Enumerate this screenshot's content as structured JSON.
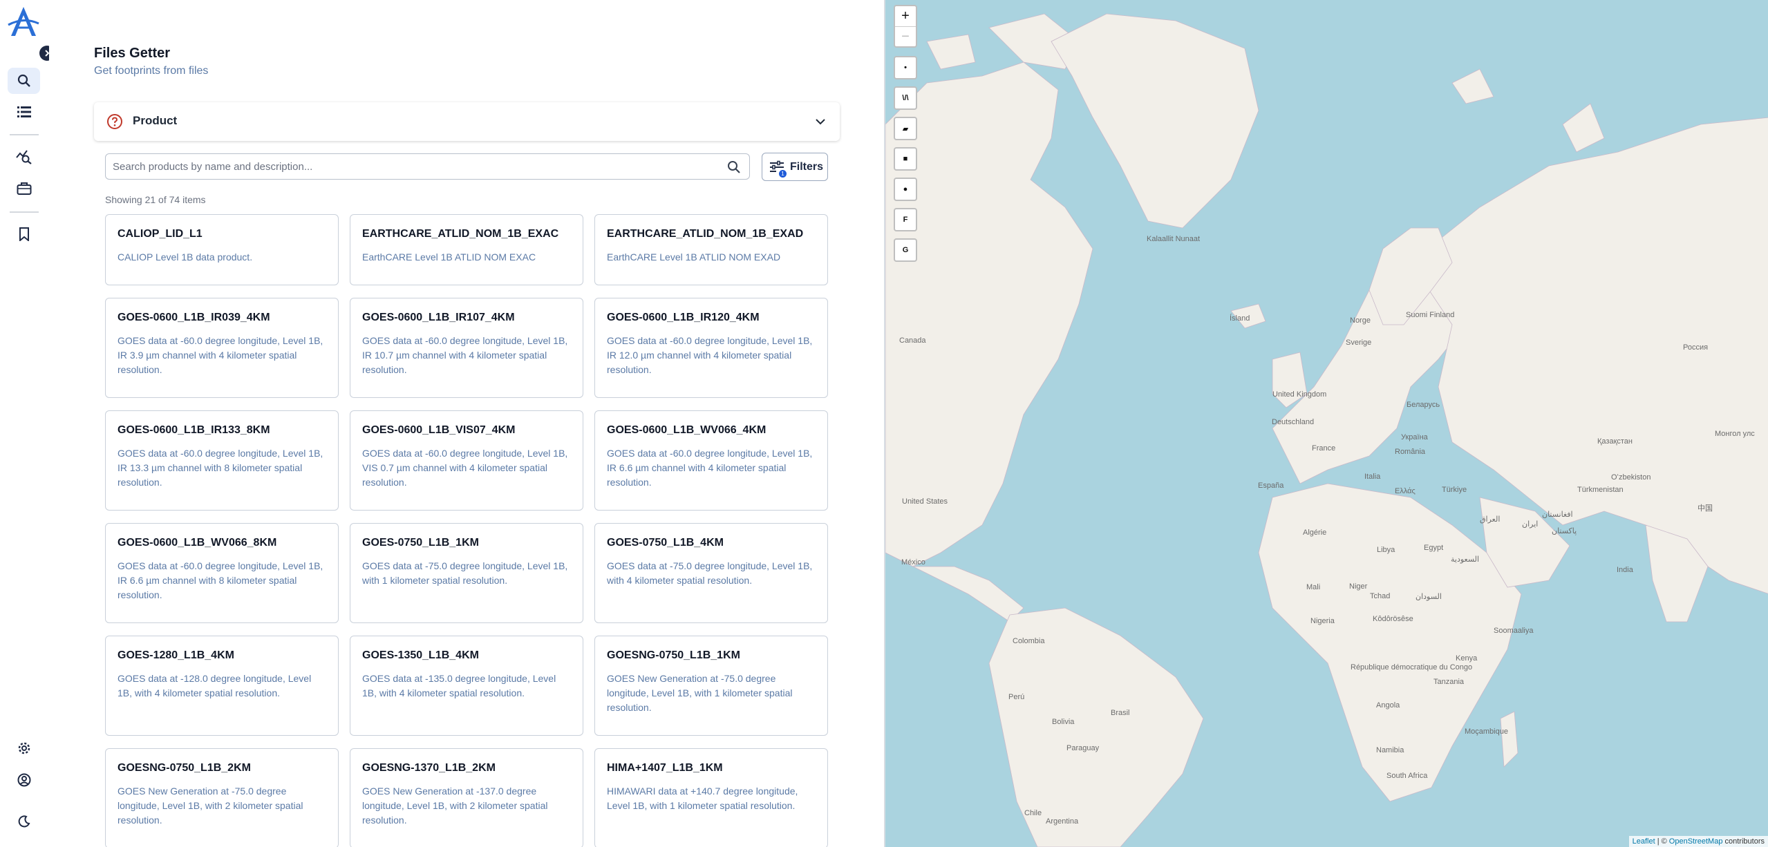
{
  "header": {
    "title": "Files Getter",
    "subtitle": "Get footprints from files"
  },
  "nav": {
    "items": [
      {
        "icon": "search-icon",
        "active": true
      },
      {
        "icon": "list-icon",
        "active": false
      },
      {
        "icon": "analytics-search-icon",
        "active": false
      },
      {
        "icon": "briefcase-icon",
        "active": false
      },
      {
        "icon": "bookmark-icon",
        "active": false
      }
    ],
    "bottom": [
      "gear-icon",
      "user-circle-icon",
      "moon-icon"
    ]
  },
  "product_panel": {
    "label": "Product"
  },
  "search": {
    "placeholder": "Search products by name and description..."
  },
  "filters": {
    "label": "Filters",
    "badge": "1"
  },
  "results": {
    "showing": "Showing 21 of 74 items"
  },
  "products": [
    {
      "name": "CALIOP_LID_L1",
      "description": "CALIOP Level 1B data product."
    },
    {
      "name": "EARTHCARE_ATLID_NOM_1B_EXAC",
      "description": "EarthCARE Level 1B ATLID NOM EXAC"
    },
    {
      "name": "EARTHCARE_ATLID_NOM_1B_EXAD",
      "description": "EarthCARE Level 1B ATLID NOM EXAD"
    },
    {
      "name": "GOES-0600_L1B_IR039_4KM",
      "description": "GOES data at -60.0 degree longitude, Level 1B, IR 3.9 µm channel with 4 kilometer spatial resolution."
    },
    {
      "name": "GOES-0600_L1B_IR107_4KM",
      "description": "GOES data at -60.0 degree longitude, Level 1B, IR 10.7 µm channel with 4 kilometer spatial resolution."
    },
    {
      "name": "GOES-0600_L1B_IR120_4KM",
      "description": "GOES data at -60.0 degree longitude, Level 1B, IR 12.0 µm channel with 4 kilometer spatial resolution."
    },
    {
      "name": "GOES-0600_L1B_IR133_8KM",
      "description": "GOES data at -60.0 degree longitude, Level 1B, IR 13.3 µm channel with 8 kilometer spatial resolution."
    },
    {
      "name": "GOES-0600_L1B_VIS07_4KM",
      "description": "GOES data at -60.0 degree longitude, Level 1B, VIS 0.7 µm channel with 4 kilometer spatial resolution."
    },
    {
      "name": "GOES-0600_L1B_WV066_4KM",
      "description": "GOES data at -60.0 degree longitude, Level 1B, IR 6.6 µm channel with 4 kilometer spatial resolution."
    },
    {
      "name": "GOES-0600_L1B_WV066_8KM",
      "description": "GOES data at -60.0 degree longitude, Level 1B, IR 6.6 µm channel with 8 kilometer spatial resolution."
    },
    {
      "name": "GOES-0750_L1B_1KM",
      "description": "GOES data at -75.0 degree longitude, Level 1B, with 1 kilometer spatial resolution."
    },
    {
      "name": "GOES-0750_L1B_4KM",
      "description": "GOES data at -75.0 degree longitude, Level 1B, with 4 kilometer spatial resolution."
    },
    {
      "name": "GOES-1280_L1B_4KM",
      "description": "GOES data at -128.0 degree longitude, Level 1B, with 4 kilometer spatial resolution."
    },
    {
      "name": "GOES-1350_L1B_4KM",
      "description": "GOES data at -135.0 degree longitude, Level 1B, with 4 kilometer spatial resolution."
    },
    {
      "name": "GOESNG-0750_L1B_1KM",
      "description": "GOES New Generation at -75.0 degree longitude, Level 1B, with 1 kilometer spatial resolution."
    },
    {
      "name": "GOESNG-0750_L1B_2KM",
      "description": "GOES New Generation at -75.0 degree longitude, Level 1B, with 2 kilometer spatial resolution."
    },
    {
      "name": "GOESNG-1370_L1B_2KM",
      "description": "GOES New Generation at -137.0 degree longitude, Level 1B, with 2 kilometer spatial resolution."
    },
    {
      "name": "HIMA+1407_L1B_1KM",
      "description": "HIMAWARI data at +140.7 degree longitude, Level 1B, with 1 kilometer spatial resolution."
    }
  ],
  "map": {
    "zoom_in": "+",
    "zoom_out": "−",
    "tools": [
      {
        "icon": "marker-tool-icon",
        "label": "•"
      },
      {
        "icon": "polyline-tool-icon",
        "label": "\\/\\"
      },
      {
        "icon": "polygon-tool-icon",
        "label": "▰"
      },
      {
        "icon": "rectangle-tool-icon",
        "label": "■"
      },
      {
        "icon": "circle-tool-icon",
        "label": "●"
      },
      {
        "icon": "f-tool-icon",
        "label": "F"
      },
      {
        "icon": "g-tool-icon",
        "label": "G"
      }
    ],
    "labels": [
      "Kalaallit Nunaat",
      "Ísland",
      "Canada",
      "Norge",
      "Sverige",
      "Suomi Finland",
      "Россия",
      "United Kingdom",
      "Беларусь",
      "Deutschland",
      "Україна",
      "France",
      "România",
      "Қазақстан",
      "Монгол улс",
      "España",
      "Italia",
      "Türkiye",
      "Ελλάς",
      "Oʻzbekiston",
      "Türkmenistan",
      "United States",
      "Algérie",
      "Libya",
      "Egypt",
      "العراق",
      "ایران",
      "افغانستان",
      "پاکستان",
      "中国",
      "México",
      "Mali",
      "Niger",
      "Tchad",
      "السودان",
      "السعودية",
      "India",
      "Nigeria",
      "Kôdôrösêse",
      "Soomaaliya",
      "Colombia",
      "Kenya",
      "République démocratique du Congo",
      "Tanzania",
      "Perú",
      "Brasil",
      "Bolivia",
      "Angola",
      "Paraguay",
      "Moçambique",
      "Namibia",
      "South Africa",
      "Chile",
      "Argentina"
    ],
    "attribution_leaflet": "Leaflet",
    "attribution_osm": "OpenStreetMap",
    "attribution_suffix": " contributors"
  },
  "colors": {
    "accent": "#1e5bd8",
    "water": "#aad3df",
    "land": "#f2efe9",
    "muted_text": "#5b7aa6"
  }
}
